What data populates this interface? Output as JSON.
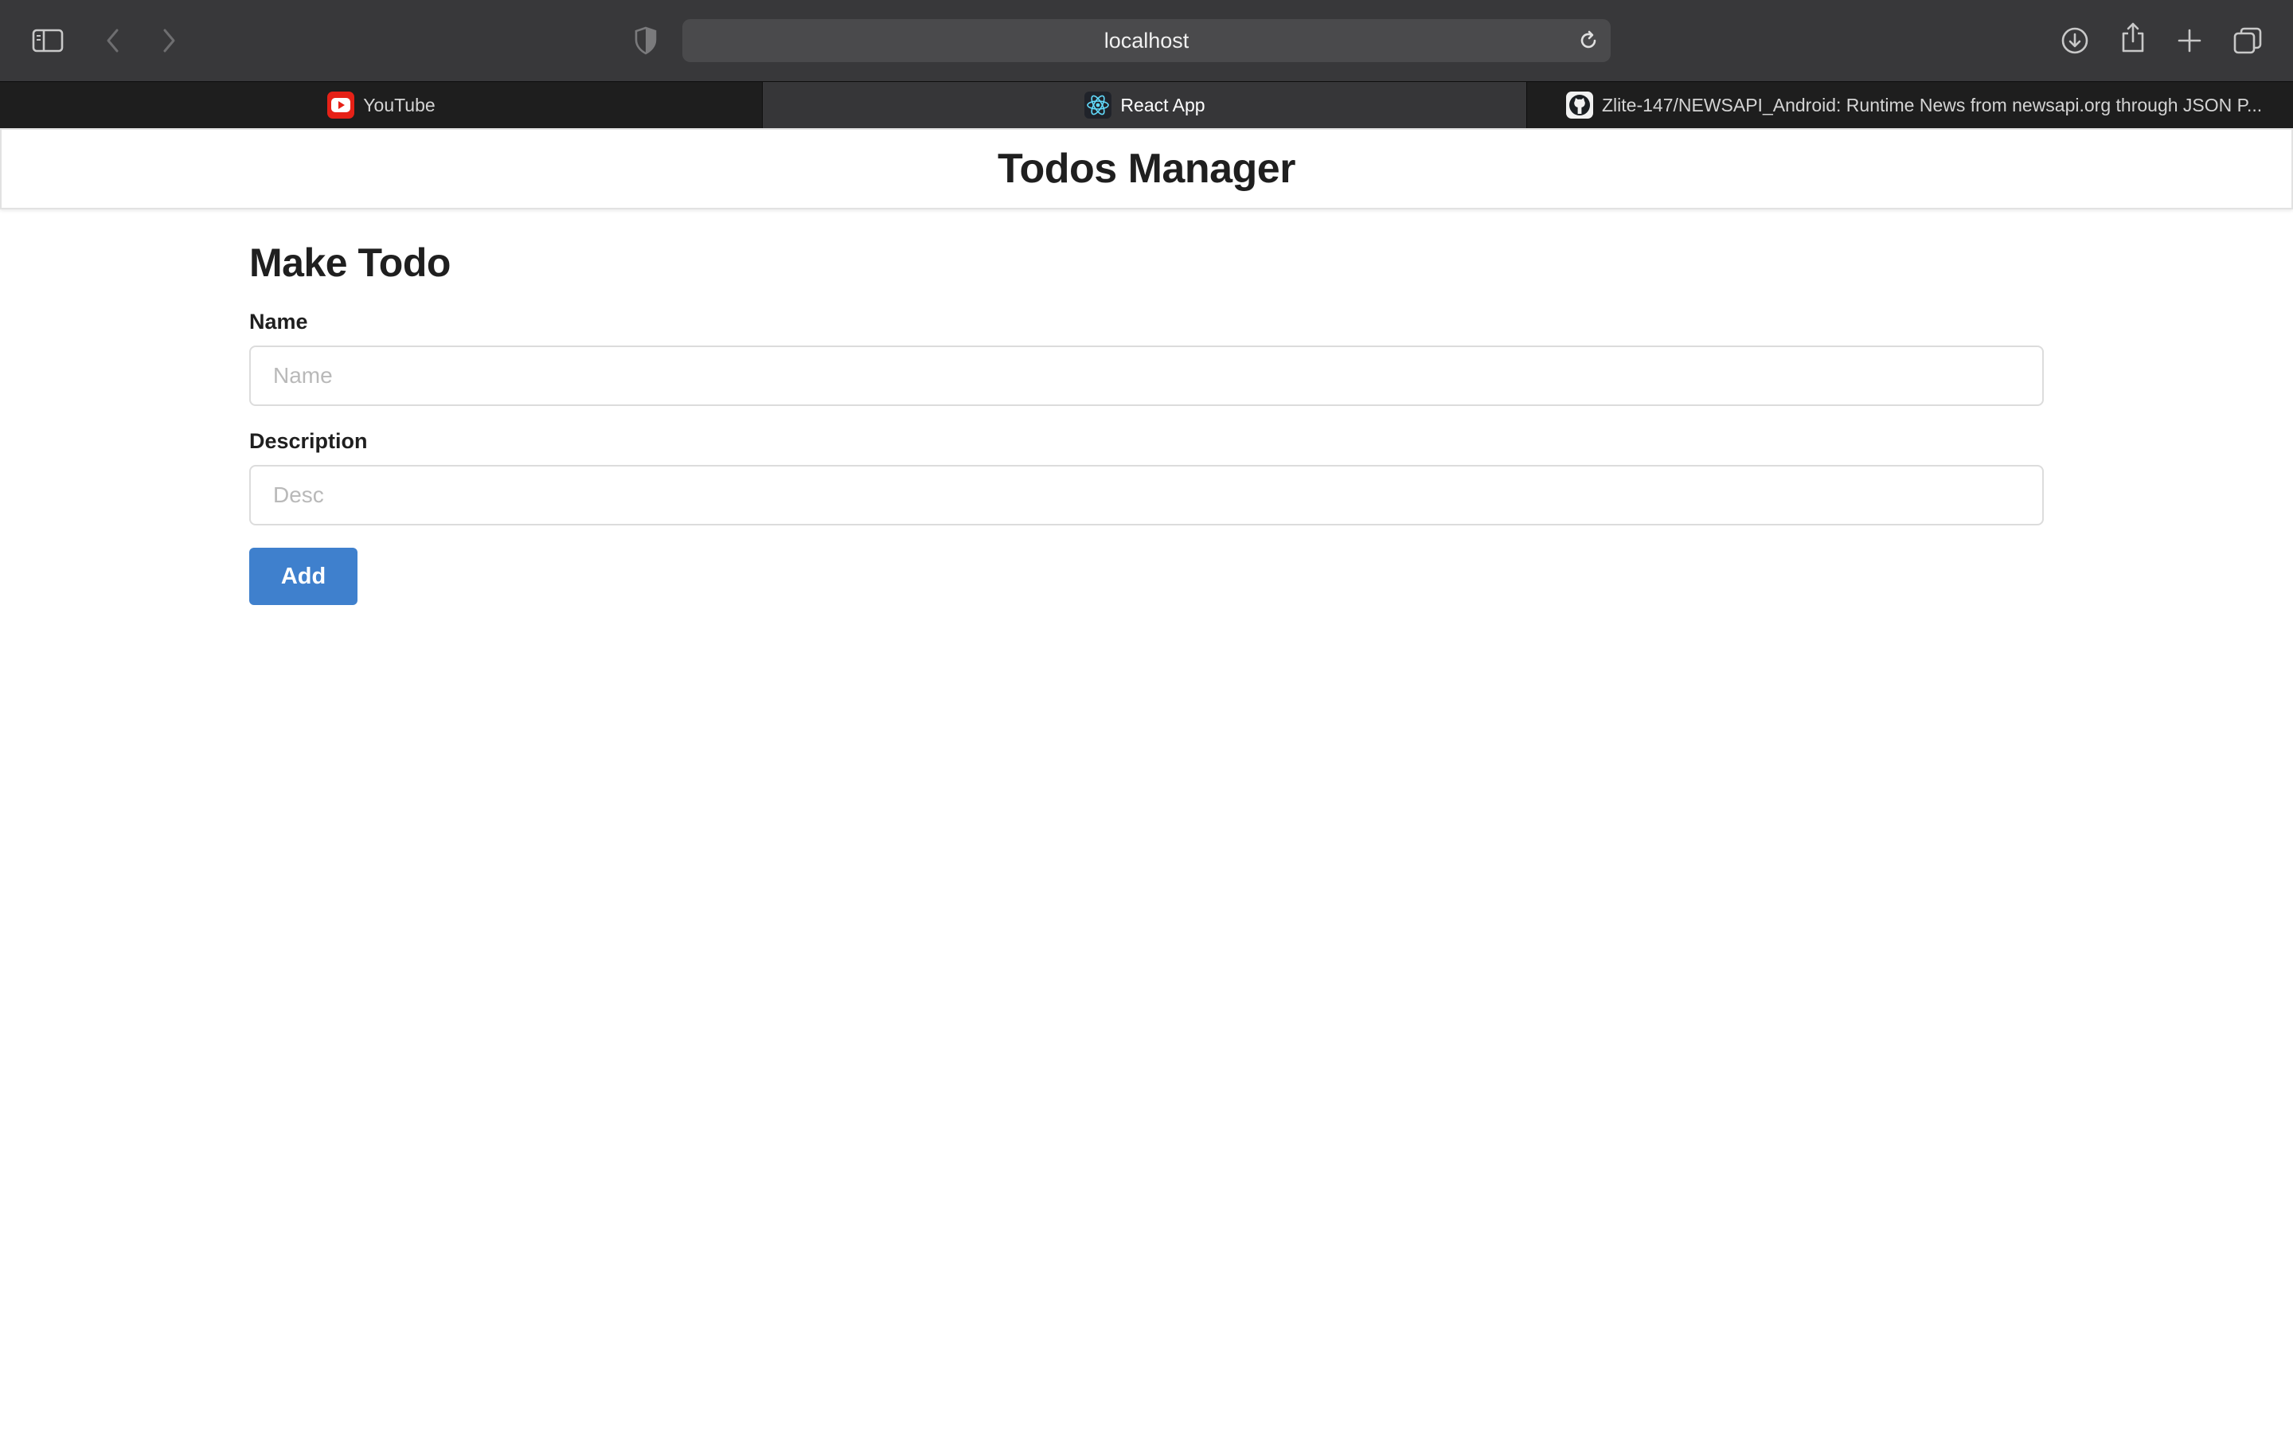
{
  "browser": {
    "url": "localhost",
    "toolbar_icons": {
      "sidebar": "sidebar-icon",
      "back": "chevron-left-icon",
      "forward": "chevron-right-icon",
      "privacy": "shield-icon",
      "reload": "reload-icon",
      "downloads": "download-icon",
      "share": "share-icon",
      "new_tab": "plus-icon",
      "tab_overview": "tabs-overview-icon"
    },
    "tabs": [
      {
        "label": "YouTube",
        "favicon": "youtube-icon",
        "active": false
      },
      {
        "label": "React App",
        "favicon": "react-icon",
        "active": true
      },
      {
        "label": "Zlite-147/NEWSAPI_Android: Runtime News from newsapi.org through JSON P...",
        "favicon": "github-icon",
        "active": false
      }
    ]
  },
  "app": {
    "title": "Todos Manager"
  },
  "form": {
    "title": "Make Todo",
    "name_label": "Name",
    "name_placeholder": "Name",
    "description_label": "Description",
    "description_placeholder": "Desc",
    "add_label": "Add"
  },
  "colors": {
    "toolbar_bg": "#38383a",
    "tabbar_bg": "#1e1e1e",
    "active_tab_bg": "#363638",
    "button_primary": "#3f80cd",
    "youtube_red": "#e62117",
    "react_blue": "#61dafb"
  }
}
